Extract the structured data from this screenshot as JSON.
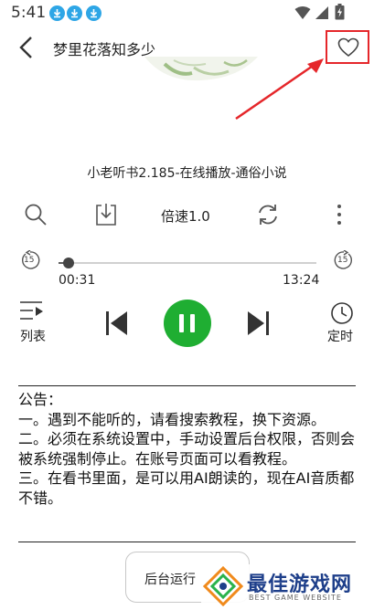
{
  "status_bar": {
    "time": "5:41"
  },
  "header": {
    "title": "梦里花落知多少"
  },
  "player": {
    "track_title": "小老听书2.185-在线播放-通俗小说",
    "speed_label": "倍速1.0",
    "current_time": "00:31",
    "total_time": "13:24",
    "progress_fraction": 0.04,
    "skip_seconds": "15",
    "list_label": "列表",
    "timer_label": "定时"
  },
  "notice": {
    "lines": [
      "公告：",
      "一。遇到不能听的，请看搜索教程，换下资源。",
      "二。必须在系统设置中，手动设置后台权限，否则会被系统强制停止。在账号页面可以看教程。",
      "三。在看书里面，是可以用AI朗读的，现在AI音质都不错。"
    ]
  },
  "bottom": {
    "background_button_label": "后台运行"
  },
  "watermark": {
    "brand": "最佳游戏网",
    "subtitle": "BEST GAME WEBSITE"
  },
  "colors": {
    "accent_green": "#1fae32",
    "highlight_red": "#e5262a",
    "badge_blue": "#2ea6e6",
    "watermark_blue": "#1e3f8a"
  }
}
